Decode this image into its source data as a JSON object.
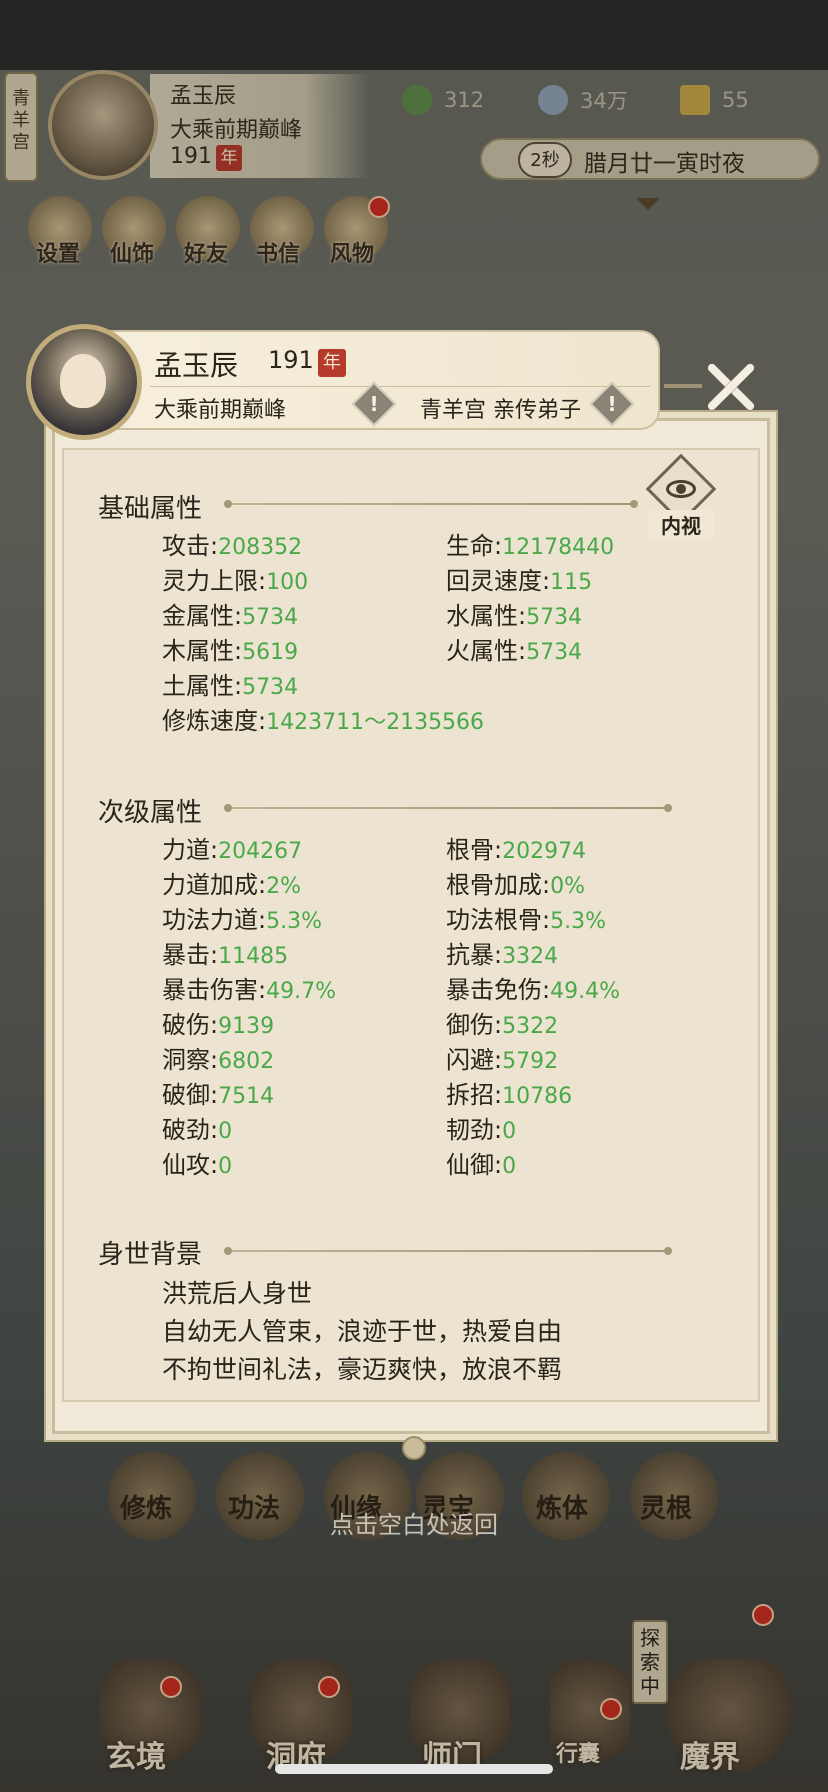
{
  "header": {
    "sect_badge": "青羊宫",
    "name": "孟玉辰",
    "realm": "大乘前期巅峰",
    "age": "191",
    "age_unit": "年",
    "resources": [
      {
        "icon": "jade-leaf-icon",
        "value": "312"
      },
      {
        "icon": "coin-icon",
        "value": "34万"
      },
      {
        "icon": "gold-token-icon",
        "value": "55"
      }
    ],
    "time_seconds": "2秒",
    "time_text": "腊月廿一寅时夜",
    "menu": [
      {
        "label": "设置"
      },
      {
        "label": "仙饰"
      },
      {
        "label": "好友"
      },
      {
        "label": "书信"
      },
      {
        "label": "风物"
      }
    ]
  },
  "card": {
    "name": "孟玉辰",
    "age": "191",
    "age_unit": "年",
    "realm": "大乘前期巅峰",
    "sect_role": "青羊宫 亲传弟子",
    "inner_view_label": "内视",
    "basic": {
      "title": "基础属性",
      "rows": [
        [
          {
            "label": "攻击",
            "value": "208352"
          },
          {
            "label": "生命",
            "value": "12178440"
          }
        ],
        [
          {
            "label": "灵力上限",
            "value": "100"
          },
          {
            "label": "回灵速度",
            "value": "115"
          }
        ],
        [
          {
            "label": "金属性",
            "value": "5734"
          },
          {
            "label": "水属性",
            "value": "5734"
          }
        ],
        [
          {
            "label": "木属性",
            "value": "5619"
          },
          {
            "label": "火属性",
            "value": "5734"
          }
        ],
        [
          {
            "label": "土属性",
            "value": "5734"
          }
        ],
        [
          {
            "label": "修炼速度",
            "value": "1423711～2135566"
          }
        ]
      ]
    },
    "secondary": {
      "title": "次级属性",
      "rows": [
        [
          {
            "label": "力道",
            "value": "204267"
          },
          {
            "label": "根骨",
            "value": "202974"
          }
        ],
        [
          {
            "label": "力道加成",
            "value": "2%"
          },
          {
            "label": "根骨加成",
            "value": "0%"
          }
        ],
        [
          {
            "label": "功法力道",
            "value": "5.3%"
          },
          {
            "label": "功法根骨",
            "value": "5.3%"
          }
        ],
        [
          {
            "label": "暴击",
            "value": "11485"
          },
          {
            "label": "抗暴",
            "value": "3324"
          }
        ],
        [
          {
            "label": "暴击伤害",
            "value": "49.7%"
          },
          {
            "label": "暴击免伤",
            "value": "49.4%"
          }
        ],
        [
          {
            "label": "破伤",
            "value": "9139"
          },
          {
            "label": "御伤",
            "value": "5322"
          }
        ],
        [
          {
            "label": "洞察",
            "value": "6802"
          },
          {
            "label": "闪避",
            "value": "5792"
          }
        ],
        [
          {
            "label": "破御",
            "value": "7514"
          },
          {
            "label": "拆招",
            "value": "10786"
          }
        ],
        [
          {
            "label": "破劲",
            "value": "0"
          },
          {
            "label": "韧劲",
            "value": "0"
          }
        ],
        [
          {
            "label": "仙攻",
            "value": "0"
          },
          {
            "label": "仙御",
            "value": "0"
          }
        ]
      ]
    },
    "background": {
      "title": "身世背景",
      "lines": [
        "洪荒后人身世",
        "自幼无人管束，浪迹于世，热爱自由",
        "不拘世间礼法，豪迈爽快，放浪不羁"
      ]
    }
  },
  "bottom_menu": [
    {
      "label": "修炼"
    },
    {
      "label": "功法"
    },
    {
      "label": "仙缘"
    },
    {
      "label": "灵宝"
    },
    {
      "label": "炼体"
    },
    {
      "label": "灵根"
    }
  ],
  "return_hint": "点击空白处返回",
  "nav": [
    {
      "label": "玄境"
    },
    {
      "label": "洞府"
    },
    {
      "label": "师门"
    },
    {
      "label": "行囊"
    },
    {
      "label": "魔界"
    }
  ],
  "explore_badge": "探索中",
  "colors": {
    "value_green": "#4aa84a",
    "age_tag_red": "#b53a2c",
    "panel_bg": "#ece4d0"
  }
}
